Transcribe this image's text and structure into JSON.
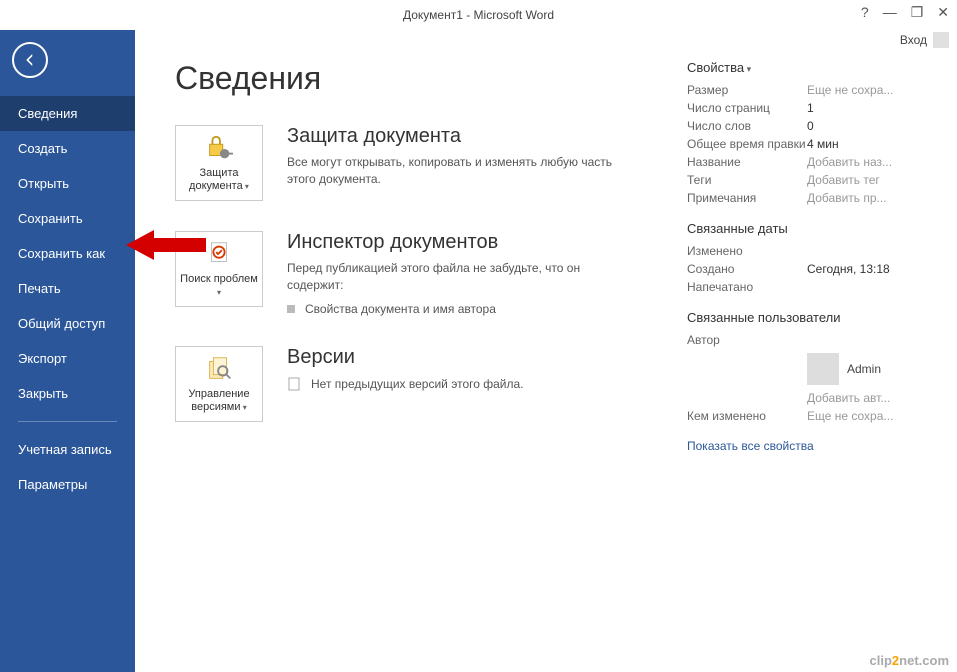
{
  "titlebar": {
    "title": "Документ1 - Microsoft Word"
  },
  "userbar": {
    "login": "Вход"
  },
  "sidebar": {
    "items": [
      {
        "label": "Сведения",
        "active": true
      },
      {
        "label": "Создать"
      },
      {
        "label": "Открыть"
      },
      {
        "label": "Сохранить"
      },
      {
        "label": "Сохранить как"
      },
      {
        "label": "Печать"
      },
      {
        "label": "Общий доступ"
      },
      {
        "label": "Экспорт"
      },
      {
        "label": "Закрыть"
      }
    ],
    "footer": [
      {
        "label": "Учетная запись"
      },
      {
        "label": "Параметры"
      }
    ]
  },
  "page": {
    "heading": "Сведения"
  },
  "protect": {
    "tile": "Защита документа",
    "title": "Защита документа",
    "desc": "Все могут открывать, копировать и изменять любую часть этого документа."
  },
  "inspect": {
    "tile": "Поиск проблем",
    "title": "Инспектор документов",
    "desc": "Перед публикацией этого файла не забудьте, что он содержит:",
    "bullet": "Свойства документа и имя автора"
  },
  "versions": {
    "tile": "Управление версиями",
    "title": "Версии",
    "desc": "Нет предыдущих версий этого файла."
  },
  "props": {
    "head": "Свойства",
    "rows": [
      {
        "label": "Размер",
        "value": "Еще не сохра...",
        "ph": true
      },
      {
        "label": "Число страниц",
        "value": "1"
      },
      {
        "label": "Число слов",
        "value": "0"
      },
      {
        "label": "Общее время правки",
        "value": "4 мин"
      },
      {
        "label": "Название",
        "value": "Добавить наз...",
        "ph": true
      },
      {
        "label": "Теги",
        "value": "Добавить тег",
        "ph": true
      },
      {
        "label": "Примечания",
        "value": "Добавить пр...",
        "ph": true
      }
    ],
    "dates_head": "Связанные даты",
    "dates": [
      {
        "label": "Изменено",
        "value": ""
      },
      {
        "label": "Создано",
        "value": "Сегодня, 13:18"
      },
      {
        "label": "Напечатано",
        "value": ""
      }
    ],
    "users_head": "Связанные пользователи",
    "author_label": "Автор",
    "author_name": "Admin",
    "add_author": "Добавить авт...",
    "changed_by_label": "Кем изменено",
    "changed_by_value": "Еще не сохра...",
    "show_all": "Показать все свойства"
  },
  "watermark": {
    "pre": "clip",
    "mid": "2",
    "post": "net",
    "suf": ".com"
  }
}
